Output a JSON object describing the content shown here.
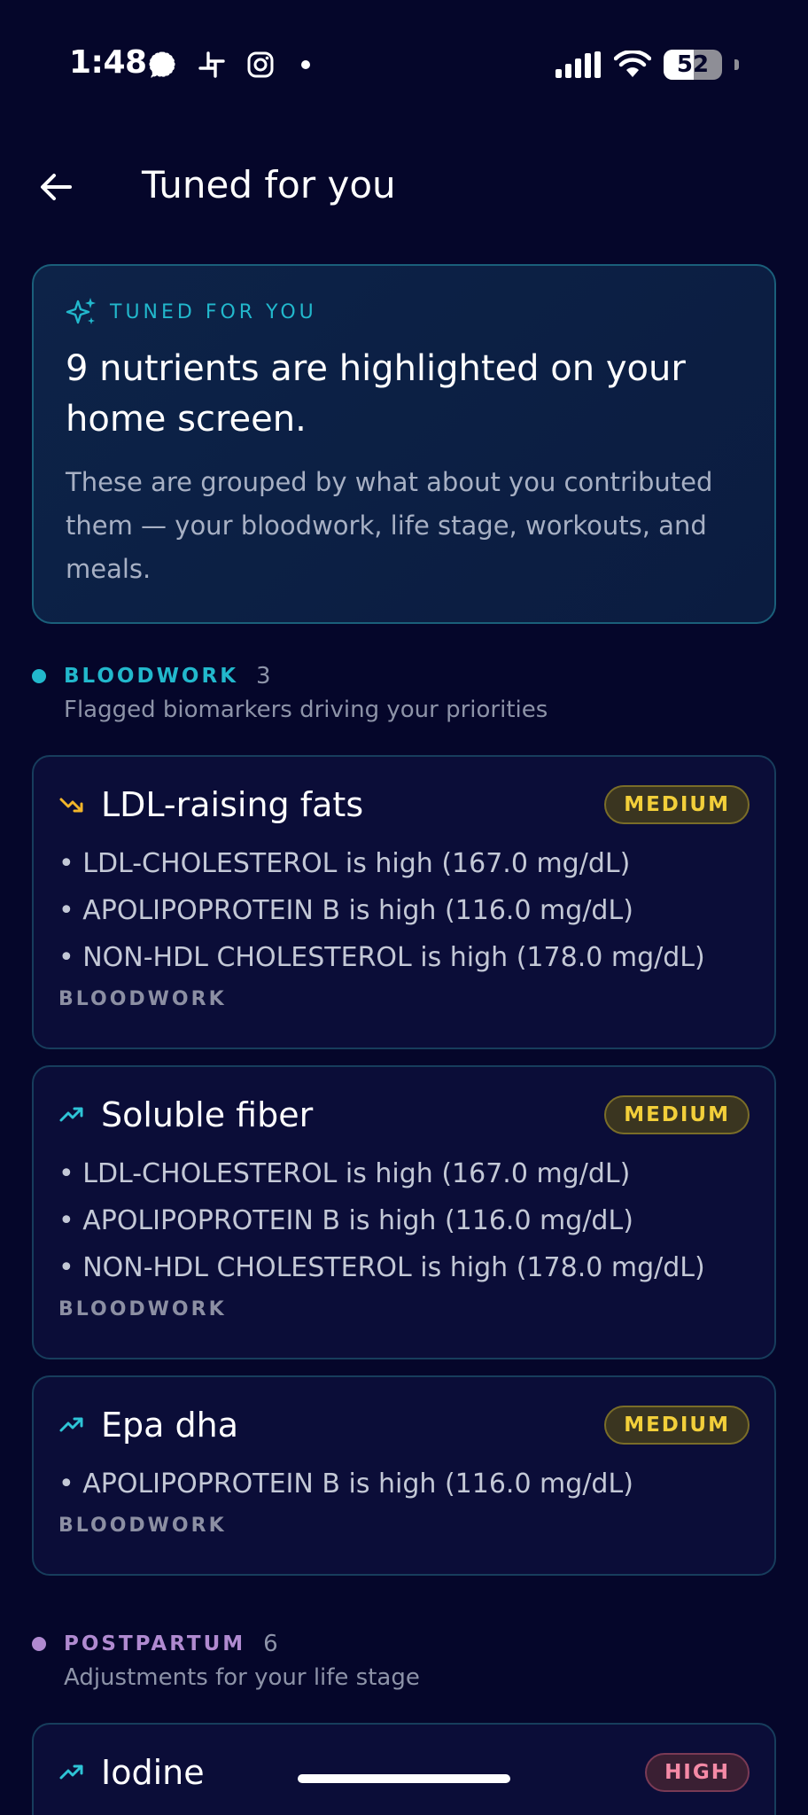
{
  "status_bar": {
    "time": "1:48",
    "battery_level": "52",
    "battery_fraction": 0.52
  },
  "header": {
    "title": "Tuned for you"
  },
  "summary": {
    "kicker": "TUNED FOR YOU",
    "heading": "9 nutrients are highlighted on your home screen.",
    "description": "These are grouped by what about you contributed them — your bloodwork, life stage, workouts, and meals."
  },
  "sections": [
    {
      "name": "BLOODWORK",
      "count": "3",
      "subtitle": "Flagged biomarkers driving your priorities",
      "color": "#22b8cc",
      "cards": [
        {
          "title": "LDL-raising fats",
          "trend": "down",
          "badge": "MEDIUM",
          "bullets": [
            "• LDL-CHOLESTEROL is high (167.0 mg/dL)",
            "• APOLIPOPROTEIN B is high (116.0 mg/dL)",
            "• NON-HDL CHOLESTEROL is high (178.0 mg/dL)"
          ],
          "source": "BLOODWORK"
        },
        {
          "title": "Soluble fiber",
          "trend": "up",
          "badge": "MEDIUM",
          "bullets": [
            "• LDL-CHOLESTEROL is high (167.0 mg/dL)",
            "• APOLIPOPROTEIN B is high (116.0 mg/dL)",
            "• NON-HDL CHOLESTEROL is high (178.0 mg/dL)"
          ],
          "source": "BLOODWORK"
        },
        {
          "title": "Epa dha",
          "trend": "up",
          "badge": "MEDIUM",
          "bullets": [
            "• APOLIPOPROTEIN B is high (116.0 mg/dL)"
          ],
          "source": "BLOODWORK"
        }
      ]
    },
    {
      "name": "POSTPARTUM",
      "count": "6",
      "subtitle": "Adjustments for your life stage",
      "color": "#b08ad0",
      "cards": [
        {
          "title": "Iodine",
          "trend": "up",
          "badge": "HIGH"
        }
      ]
    }
  ],
  "colors": {
    "background": "#05062a",
    "accent_teal": "#22b8cc",
    "trend_down": "#f2b52a",
    "trend_up": "#2ec4d6",
    "badge_medium": "#f2cf3a",
    "badge_high": "#f58aa6"
  },
  "icons": {
    "status_apps": [
      "signal-messenger-icon",
      "slack-icon",
      "instagram-icon"
    ],
    "back": "arrow-left-icon",
    "sparkle": "sparkle-icon",
    "trend_up": "trending-up-icon",
    "trend_down": "trending-down-icon"
  }
}
